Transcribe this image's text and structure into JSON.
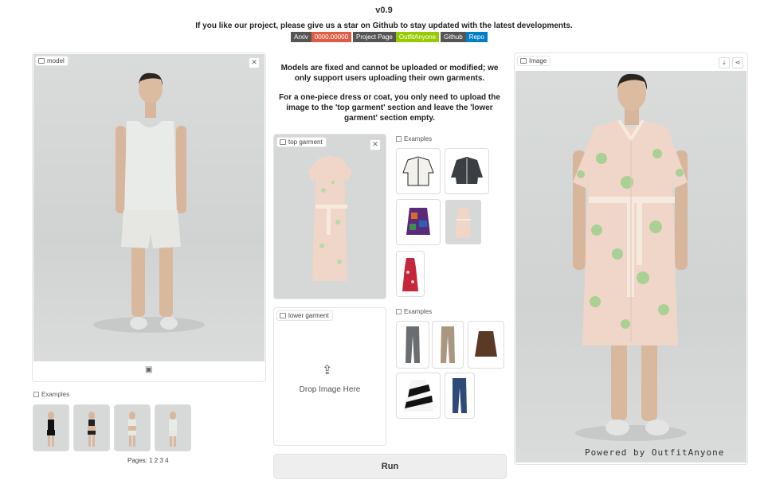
{
  "header": {
    "version": "v0.9",
    "subtitle": "If you like our project, please give us a star on Github to stay updated with the latest developments.",
    "badges": [
      {
        "label": "Arxiv",
        "color": "#555555"
      },
      {
        "label": "0000.00000",
        "color": "#e05d44"
      },
      {
        "label": "Project Page",
        "color": "#555555"
      },
      {
        "label": "OutfitAnyone",
        "color": "#97ca00"
      },
      {
        "label": "Github",
        "color": "#555555"
      },
      {
        "label": "Repo",
        "color": "#007ec6"
      }
    ]
  },
  "model_panel": {
    "label": "model",
    "examples_label": "Examples",
    "pages_text": "Pages: 1 2 3 4"
  },
  "info": {
    "line1": "Models are fixed and cannot be uploaded or modified; we only support users uploading their own garments.",
    "line2": "For a one-piece dress or coat, you only need to upload the image to the 'top garment' section and leave the 'lower garment' section empty."
  },
  "top_garment": {
    "label": "top garment",
    "examples_label": "Examples"
  },
  "lower_garment": {
    "label": "lower garment",
    "drop_text": "Drop Image Here",
    "examples_label": "Examples"
  },
  "output_panel": {
    "label": "Image",
    "watermark": "Powered by OutfitAnyone"
  },
  "run_button": {
    "label": "Run"
  },
  "colors": {
    "dress_base": "#efd6c8",
    "dress_pattern": "#9fcf8e",
    "tank_top": "#e8ebe7",
    "shorts": "#e6e6e2",
    "background_grey": "#d3d6d4"
  }
}
